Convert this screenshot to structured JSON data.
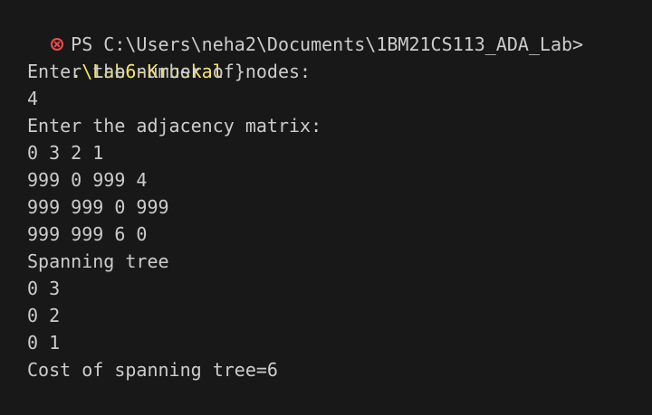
{
  "terminal": {
    "prompt_text": "PS C:\\Users\\neha2\\Documents\\1BM21CS113_ADA_Lab>",
    "command": ".\\Lab6-Kruskal",
    "command_suffix": " }",
    "output_lines": [
      "Enter the number of nodes:",
      "4",
      "Enter the adjacency matrix:",
      "0 3 2 1",
      "999 0 999 4",
      "999 999 0 999",
      "999 999 6 0",
      "Spanning tree",
      "0 3",
      "0 2",
      "0 1",
      "Cost of spanning tree=6"
    ],
    "status_icon": "error-circle-icon"
  },
  "colors": {
    "background": "#181818",
    "text": "#cccccc",
    "command": "#f5e663",
    "error": "#f14c4c"
  }
}
